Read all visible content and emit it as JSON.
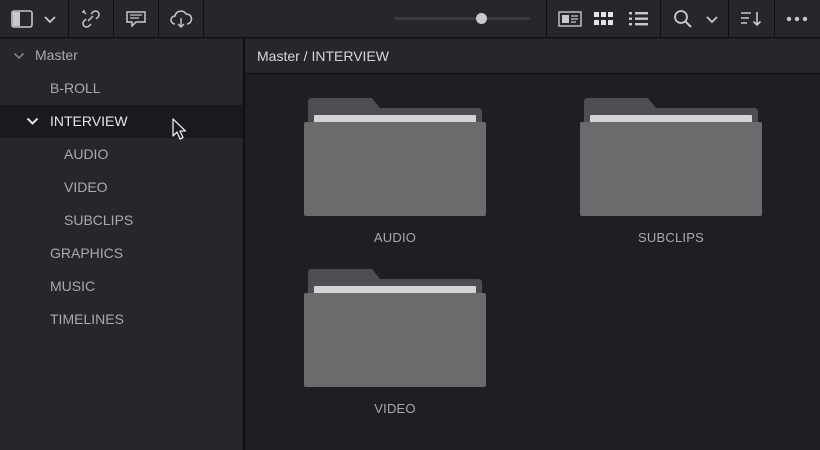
{
  "toolbar": {
    "buttons": [
      {
        "name": "panel-toggle-icon"
      },
      {
        "name": "chevron-down-icon"
      },
      {
        "name": "unlink-icon"
      },
      {
        "name": "caption-icon"
      },
      {
        "name": "cloud-sync-icon"
      },
      {
        "name": "metadata-view-icon"
      },
      {
        "name": "grid-view-icon"
      },
      {
        "name": "list-view-icon"
      },
      {
        "name": "search-icon"
      },
      {
        "name": "sort-icon"
      },
      {
        "name": "more-options-icon"
      }
    ],
    "thumbnail_zoom": 0.64,
    "active_view": "grid"
  },
  "sidebar": {
    "items": [
      {
        "label": "Master",
        "level": 0,
        "expanded": true,
        "selected": false
      },
      {
        "label": "B-ROLL",
        "level": 1,
        "expanded": false,
        "selected": false
      },
      {
        "label": "INTERVIEW",
        "level": 1,
        "expanded": true,
        "selected": true
      },
      {
        "label": "AUDIO",
        "level": 2,
        "expanded": false,
        "selected": false
      },
      {
        "label": "VIDEO",
        "level": 2,
        "expanded": false,
        "selected": false
      },
      {
        "label": "SUBCLIPS",
        "level": 2,
        "expanded": false,
        "selected": false
      },
      {
        "label": "GRAPHICS",
        "level": 1,
        "expanded": false,
        "selected": false
      },
      {
        "label": "MUSIC",
        "level": 1,
        "expanded": false,
        "selected": false
      },
      {
        "label": "TIMELINES",
        "level": 1,
        "expanded": false,
        "selected": false
      }
    ]
  },
  "breadcrumb": {
    "path": "Master / INTERVIEW"
  },
  "content": {
    "folders": [
      {
        "label": "AUDIO"
      },
      {
        "label": "SUBCLIPS"
      },
      {
        "label": "VIDEO"
      }
    ]
  },
  "colors": {
    "background": "#1e1e23",
    "panel": "#26262c",
    "selected_row": "#1a1a1e",
    "folder_front": "#6b6b6e",
    "folder_back": "#4e4e52"
  }
}
